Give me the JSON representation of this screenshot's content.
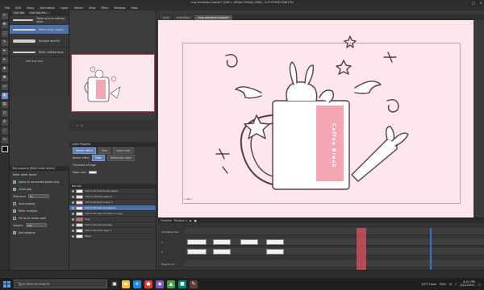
{
  "window": {
    "title": "mug animation tutorial* (1500 x 1050px 300dpi) (RGB) - CLIP STUDIO PAINT EX"
  },
  "menu": [
    "File",
    "Edit",
    "Story",
    "Animation",
    "Layer",
    "Select",
    "View",
    "Filter",
    "Window",
    "Help"
  ],
  "subtool_panel": {
    "tabs": [
      "Sub Tool",
      "Sub Tool Pre..."
    ],
    "items": [
      {
        "label": "Refer only to editing layer",
        "selected": false
      },
      {
        "label": "Refer other layers",
        "selected": true
      },
      {
        "label": "Enclose and fill",
        "selected": false
      },
      {
        "label": "Paint unfilled area",
        "selected": false
      }
    ],
    "add_label": "Add sub tool"
  },
  "tool_property": {
    "title": "Tool property [Refer other layers]",
    "subtitle": "Refer other layers",
    "rows": [
      {
        "label": "Apply to connected pixels only",
        "checked": true
      },
      {
        "label": "Close gap",
        "checked": true
      },
      {
        "label": "Tolerance",
        "value": "10"
      },
      {
        "label": "Area scaling",
        "checked": false
      },
      {
        "label": "Refer multiple",
        "checked": true
      },
      {
        "label": "Fill up to vector path",
        "checked": false
      },
      {
        "label": "Opacity",
        "value": "100"
      },
      {
        "label": "Anti-aliasing",
        "checked": true
      }
    ]
  },
  "layer_property": {
    "title": "Layer Property",
    "effect_buttons": [
      {
        "label": "Border effect",
        "on": true
      },
      {
        "label": "Tone",
        "on": false
      },
      {
        "label": "Layer color",
        "on": false
      }
    ],
    "border_effect": {
      "label": "Border effect",
      "edge": "Edge",
      "watercolor": "Watercolor edge"
    },
    "thickness_label": "Thickness of edge",
    "edge_color_label": "Edge color"
  },
  "layers": {
    "blend_mode": "Normal",
    "items": [
      {
        "name": "100 % Normal Rough paper",
        "thumb": "white",
        "selected": false
      },
      {
        "name": "100 % Overlay Layer 5",
        "thumb": "pink",
        "selected": false
      },
      {
        "name": "100 % Multiply Layer 4",
        "thumb": "pink",
        "selected": false
      },
      {
        "name": "100 % Normal doodles lin",
        "thumb": "pink",
        "selected": true
      },
      {
        "name": "100 % Normal doodles lin Copy",
        "thumb": "pink",
        "selected": false
      },
      {
        "name": "Mug",
        "thumb": "red",
        "selected": false
      },
      {
        "name": "100 % Normal doodles",
        "thumb": "pink",
        "selected": false
      },
      {
        "name": "100 % Normal Layer 1",
        "thumb": "white",
        "selected": false
      },
      {
        "name": "Paper",
        "thumb": "white",
        "selected": false
      }
    ]
  },
  "document_tabs": [
    {
      "label": "mug",
      "active": false
    },
    {
      "label": "Animation",
      "active": false
    },
    {
      "label": "mug animation tutorial*",
      "active": true
    }
  ],
  "canvas": {
    "frame_label": "1 Ilåns",
    "mug_text": "Coffee Break"
  },
  "timeline": {
    "title": "Timeline",
    "name": "Timeline 1",
    "tracks": [
      {
        "label": "Animation Cel"
      },
      {
        "label": "1"
      },
      {
        "label": "2"
      },
      {
        "label": "Mug 01 cel"
      }
    ]
  },
  "taskbar": {
    "search_placeholder": "Type here to search",
    "weather": "10°F Haze",
    "language": "ENG",
    "time": "4:21 PM",
    "date": "2/22/2022"
  },
  "colors": {
    "accent": "#6b8cc7",
    "canvas_bg": "#fde6ec",
    "mug_fill": "#f4a7b3",
    "line": "#5a3a40"
  }
}
